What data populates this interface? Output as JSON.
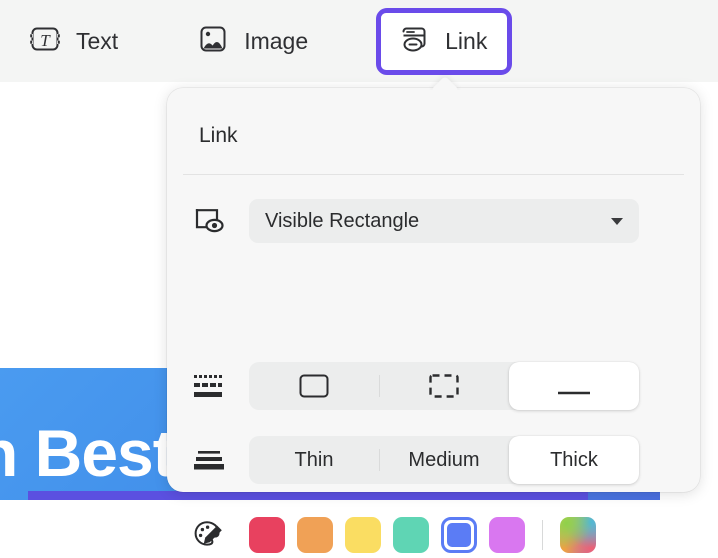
{
  "toolbar": {
    "items": [
      {
        "label": "Text",
        "icon": "text-frame-icon",
        "selected": false
      },
      {
        "label": "Image",
        "icon": "image-icon",
        "selected": false
      },
      {
        "label": "Link",
        "icon": "link-window-icon",
        "selected": true
      }
    ],
    "background_color": "#f4f5f4",
    "selection_color": "#6a4bea"
  },
  "panel": {
    "title": "Link",
    "background_color": "#f7f7f7",
    "visibility": {
      "icon": "rectangle-eye-icon",
      "value": "Visible Rectangle",
      "caret": "chevron-down-icon",
      "options": [
        "Visible Rectangle"
      ]
    },
    "border_style": {
      "icon": "line-styles-icon",
      "options": [
        {
          "name": "solid-rectangle",
          "selected": false
        },
        {
          "name": "dashed-rectangle",
          "selected": false
        },
        {
          "name": "underline",
          "selected": true
        }
      ]
    },
    "thickness": {
      "icon": "line-weight-icon",
      "options": [
        {
          "label": "Thin",
          "selected": false
        },
        {
          "label": "Medium",
          "selected": false
        },
        {
          "label": "Thick",
          "selected": true
        }
      ]
    },
    "color": {
      "icon": "palette-brush-icon",
      "swatches": [
        {
          "name": "red",
          "hex": "#e8415f",
          "selected": false
        },
        {
          "name": "orange",
          "hex": "#f0a156",
          "selected": false
        },
        {
          "name": "yellow",
          "hex": "#fadd62",
          "selected": false
        },
        {
          "name": "teal",
          "hex": "#5fd5b4",
          "selected": false
        },
        {
          "name": "blue",
          "hex": "#5b7cf5",
          "selected": true
        },
        {
          "name": "magenta",
          "hex": "#d977f0",
          "selected": false
        }
      ],
      "custom": {
        "name": "rainbow-gradient",
        "selected": false
      }
    }
  },
  "background": {
    "hero_text": "n Best",
    "hero_color": "#3f8ce8",
    "underline_color": "#5b50e0"
  }
}
